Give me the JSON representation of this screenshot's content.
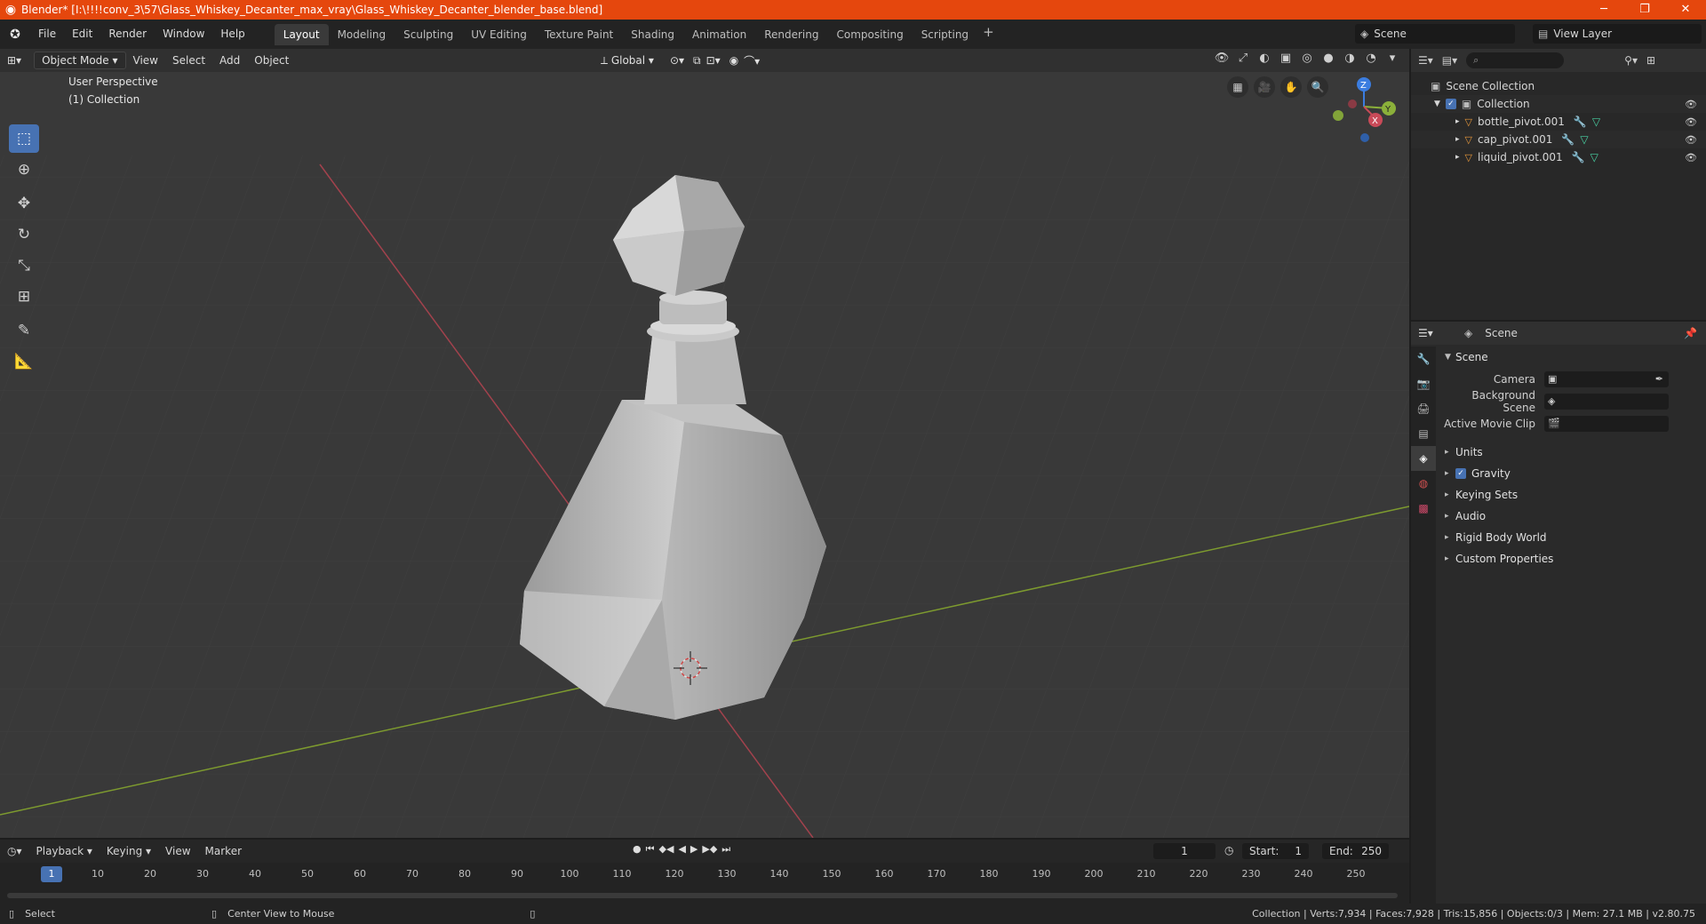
{
  "window": {
    "title": "Blender* [I:\\!!!!conv_3\\57\\Glass_Whiskey_Decanter_max_vray\\Glass_Whiskey_Decanter_blender_base.blend]"
  },
  "menus": [
    "File",
    "Edit",
    "Render",
    "Window",
    "Help"
  ],
  "workspaces": [
    "Layout",
    "Modeling",
    "Sculpting",
    "UV Editing",
    "Texture Paint",
    "Shading",
    "Animation",
    "Rendering",
    "Compositing",
    "Scripting"
  ],
  "active_workspace": "Layout",
  "scene_name": "Scene",
  "view_layer": "View Layer",
  "viewport": {
    "mode": "Object Mode",
    "menus": [
      "View",
      "Select",
      "Add",
      "Object"
    ],
    "orientation": "Global",
    "perspective_label": "User Perspective",
    "collection_label": "(1) Collection",
    "gizmo": {
      "z": "Z",
      "y": "Y",
      "x": "X"
    }
  },
  "outliner": {
    "root": "Scene Collection",
    "collection": "Collection",
    "items": [
      "bottle_pivot.001",
      "cap_pivot.001",
      "liquid_pivot.001"
    ]
  },
  "properties": {
    "header": "Scene",
    "panel": "Scene",
    "camera_label": "Camera",
    "background_scene_label": "Background Scene",
    "movie_clip_label": "Active Movie Clip",
    "sections": [
      "Units",
      "Gravity",
      "Keying Sets",
      "Audio",
      "Rigid Body World",
      "Custom Properties"
    ]
  },
  "timeline": {
    "menus": [
      "Playback",
      "Keying",
      "View",
      "Marker"
    ],
    "current_frame": "1",
    "start_label": "Start:",
    "start": "1",
    "end_label": "End:",
    "end": "250",
    "ruler": [
      "10",
      "20",
      "30",
      "40",
      "50",
      "60",
      "70",
      "80",
      "90",
      "100",
      "110",
      "120",
      "130",
      "140",
      "150",
      "160",
      "170",
      "180",
      "190",
      "200",
      "210",
      "220",
      "230",
      "240",
      "250"
    ]
  },
  "status": {
    "left": "Select",
    "middle": "Center View to Mouse",
    "right": "Collection | Verts:7,934 | Faces:7,928 | Tris:15,856 | Objects:0/3 | Mem: 27.1 MB | v2.80.75"
  },
  "colors": {
    "titlebar": "#e5470d",
    "accent": "#4772b3",
    "x_axis": "#c94a58",
    "y_axis": "#8bb03a"
  }
}
